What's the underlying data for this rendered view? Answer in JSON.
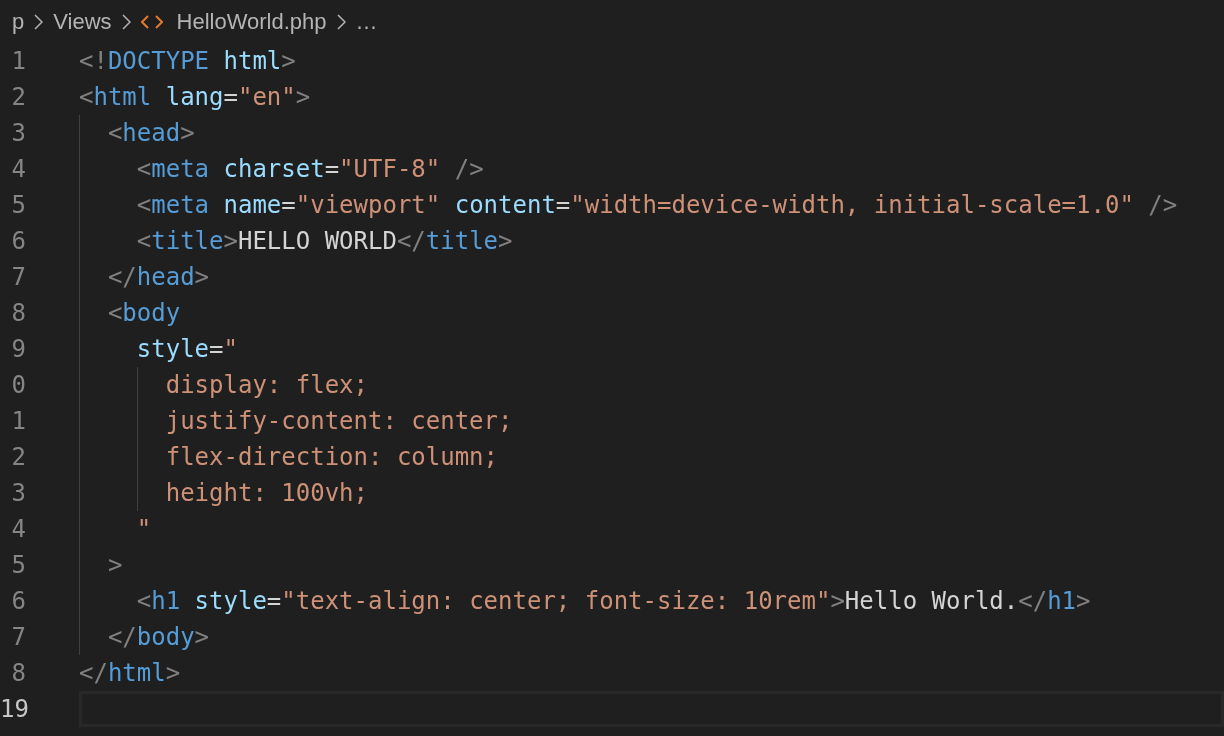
{
  "breadcrumb": [
    {
      "kind": "folder",
      "text": "p"
    },
    {
      "kind": "folder",
      "text": "Views"
    },
    {
      "kind": "file",
      "text": "HelloWorld.php"
    },
    {
      "kind": "more",
      "text": "…"
    }
  ],
  "lines": [
    {
      "number": "1",
      "current": false,
      "code": "<!DOCTYPE html>"
    },
    {
      "number": "2",
      "current": false,
      "code": "<html lang=\"en\">",
      "children": [
        {
          "number": "3",
          "current": false,
          "code": "<head>",
          "children": [
            {
              "number": "4",
              "current": false,
              "code": "<meta charset=\"UTF-8\" />"
            },
            {
              "number": "5",
              "current": false,
              "code": "<meta name=\"viewport\" content=\"width=device-width, initial-scale=1.0\" />"
            },
            {
              "number": "6",
              "current": false,
              "code": "<title>HELLO WORLD</title>"
            }
          ]
        },
        {
          "number": "7",
          "current": false,
          "code": "</head>"
        },
        {
          "number": "8",
          "current": false,
          "code": "<body",
          "children": [
            {
              "number": "9",
              "current": false,
              "code": "style=\"",
              "children": [
                {
                  "number": "0",
                  "current": false,
                  "code": "display: flex;"
                },
                {
                  "number": "1",
                  "current": false,
                  "code": "justify-content: center;"
                },
                {
                  "number": "2",
                  "current": false,
                  "code": "flex-direction: column;"
                },
                {
                  "number": "3",
                  "current": false,
                  "code": "height: 100vh;"
                }
              ]
            },
            {
              "number": "4",
              "current": false,
              "code": "\""
            }
          ]
        },
        {
          "number": "5",
          "current": false,
          "code": ">",
          "children": [
            {
              "number": "6",
              "current": false,
              "code": "<h1 style=\"text-align: center; font-size: 10rem\">Hello World.</h1>"
            }
          ]
        },
        {
          "number": "7",
          "current": false,
          "code": "</body>"
        }
      ]
    },
    {
      "number": "8",
      "current": false,
      "code": "</html>"
    },
    {
      "number": "19",
      "current": true
    }
  ]
}
